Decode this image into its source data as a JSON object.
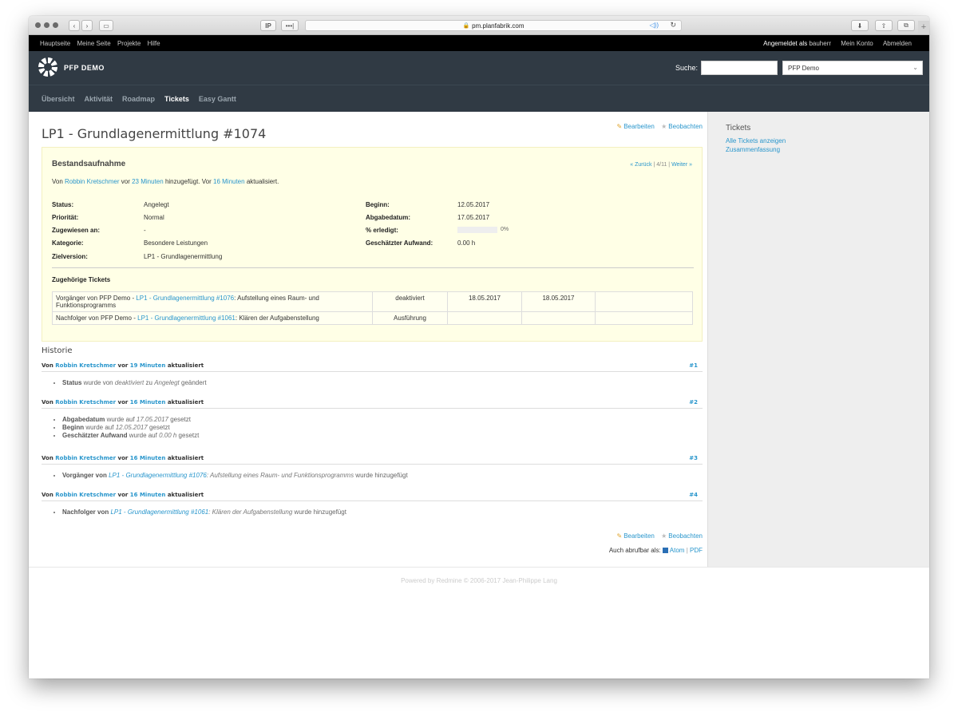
{
  "browser": {
    "url": "pm.planfabrik.com",
    "btn_ip": "IP",
    "btn_dots": "•••|"
  },
  "topmenu": {
    "items": [
      "Hauptseite",
      "Meine Seite",
      "Projekte",
      "Hilfe"
    ],
    "logged_in_label": "Angemeldet als",
    "user": "bauherr",
    "account": "Mein Konto",
    "logout": "Abmelden"
  },
  "header": {
    "site_title": "PFP DEMO",
    "search_label": "Suche:",
    "project_select": "PFP Demo"
  },
  "mainmenu": [
    "Übersicht",
    "Aktivität",
    "Roadmap",
    "Tickets",
    "Easy Gantt"
  ],
  "issue": {
    "title": "LP1 - Grundlagenermittlung #1074",
    "edit": "Bearbeiten",
    "watch": "Beobachten",
    "subject": "Bestandsaufnahme",
    "prev_next": {
      "back": "« Zurück",
      "count": "4/11",
      "next": "Weiter »"
    },
    "author": {
      "pre": "Von",
      "name": "Robbin Kretschmer",
      "mid": "vor",
      "added": "23 Minuten",
      "mid2": "hinzugefügt. Vor",
      "updated": "16 Minuten",
      "post": "aktualisiert."
    },
    "attributes_left": [
      {
        "k": "Status:",
        "v": "Angelegt"
      },
      {
        "k": "Priorität:",
        "v": "Normal"
      },
      {
        "k": "Zugewiesen an:",
        "v": "-"
      },
      {
        "k": "Kategorie:",
        "v": "Besondere Leistungen"
      },
      {
        "k": "Zielversion:",
        "v": "LP1 - Grundlagenermittlung"
      }
    ],
    "attributes_right": [
      {
        "k": "Beginn:",
        "v": "12.05.2017"
      },
      {
        "k": "Abgabedatum:",
        "v": "17.05.2017"
      },
      {
        "k": "% erledigt:",
        "v": "0%"
      },
      {
        "k": "Geschätzter Aufwand:",
        "v": "0.00 h"
      }
    ],
    "done_ratio": 0,
    "relations_title": "Zugehörige Tickets",
    "relations": [
      {
        "pre": "Vorgänger von PFP Demo - ",
        "link": "LP1 - Grundlagenermittlung #1076",
        "text": ": Aufstellung eines Raum- und Funktionsprogramms",
        "status": "deaktiviert",
        "start": "18.05.2017",
        "due": "18.05.2017"
      },
      {
        "pre": "Nachfolger von PFP Demo - ",
        "link": "LP1 - Grundlagenermittlung #1061",
        "text": ": Klären der Aufgabenstellung",
        "status": "Ausführung",
        "start": "",
        "due": ""
      }
    ]
  },
  "history": {
    "title": "Historie",
    "journals": [
      {
        "pre": "Von",
        "author": "Robbin Kretschmer",
        "mid": "vor",
        "ago": "19 Minuten",
        "post": "aktualisiert",
        "num": "#1",
        "details": [
          {
            "label": "Status",
            "t1": " wurde von ",
            "i1": "deaktiviert",
            "t2": " zu ",
            "i2": "Angelegt",
            "t3": " geändert"
          }
        ]
      },
      {
        "pre": "Von",
        "author": "Robbin Kretschmer",
        "mid": "vor",
        "ago": "16 Minuten",
        "post": "aktualisiert",
        "num": "#2",
        "details": [
          {
            "label": "Abgabedatum",
            "t1": " wurde auf ",
            "i1": "17.05.2017",
            "t2": " gesetzt",
            "i2": "",
            "t3": ""
          },
          {
            "label": "Beginn",
            "t1": " wurde auf ",
            "i1": "12.05.2017",
            "t2": " gesetzt",
            "i2": "",
            "t3": ""
          },
          {
            "label": "Geschätzter Aufwand",
            "t1": " wurde auf ",
            "i1": "0.00 h",
            "t2": " gesetzt",
            "i2": "",
            "t3": ""
          }
        ]
      },
      {
        "pre": "Von",
        "author": "Robbin Kretschmer",
        "mid": "vor",
        "ago": "16 Minuten",
        "post": "aktualisiert",
        "num": "#3",
        "details": [
          {
            "label": "Vorgänger von",
            "t1": " ",
            "i1": "LP1 - Grundlagenermittlung #1076",
            "t2": "",
            "i2": ": Aufstellung eines Raum- und Funktionsprogramms",
            "t3": " wurde hinzugefügt"
          }
        ]
      },
      {
        "pre": "Von",
        "author": "Robbin Kretschmer",
        "mid": "vor",
        "ago": "16 Minuten",
        "post": "aktualisiert",
        "num": "#4",
        "details": [
          {
            "label": "Nachfolger von",
            "t1": " ",
            "i1": "LP1 - Grundlagenermittlung #1061",
            "t2": "",
            "i2": ": Klären der Aufgabenstellung",
            "t3": " wurde hinzugefügt"
          }
        ]
      }
    ]
  },
  "formats": {
    "label": "Auch abrufbar als:",
    "atom": "Atom",
    "sep": "|",
    "pdf": "PDF"
  },
  "sidebar": {
    "title": "Tickets",
    "link1": "Alle Tickets anzeigen",
    "link2": "Zusammenfassung"
  },
  "footer": "Powered by Redmine © 2006-2017 Jean-Philippe Lang"
}
